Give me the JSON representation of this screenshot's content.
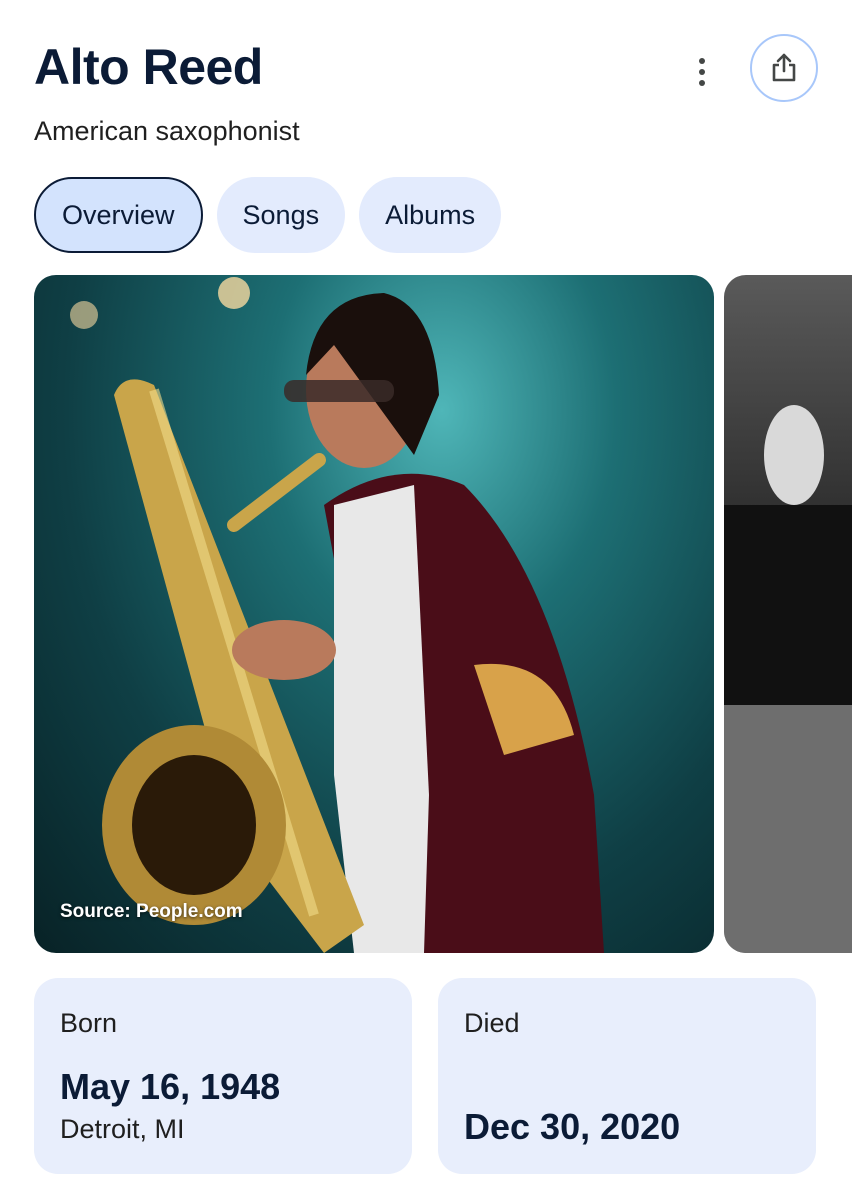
{
  "header": {
    "title": "Alto Reed",
    "subtitle": "American saxophonist"
  },
  "icons": {
    "more": "more-vert-icon",
    "share": "share-icon"
  },
  "tabs": [
    {
      "label": "Overview",
      "active": true
    },
    {
      "label": "Songs",
      "active": false
    },
    {
      "label": "Albums",
      "active": false
    }
  ],
  "gallery": {
    "source": "Source: People.com"
  },
  "facts": {
    "born": {
      "label": "Born",
      "date": "May 16, 1948",
      "place": "Detroit, MI"
    },
    "died": {
      "label": "Died",
      "date": "Dec 30, 2020"
    }
  },
  "colors": {
    "accent": "#0b1b36",
    "chip": "#e3ebfd",
    "card": "#e8eefc",
    "share_ring": "#a8c7fa"
  }
}
